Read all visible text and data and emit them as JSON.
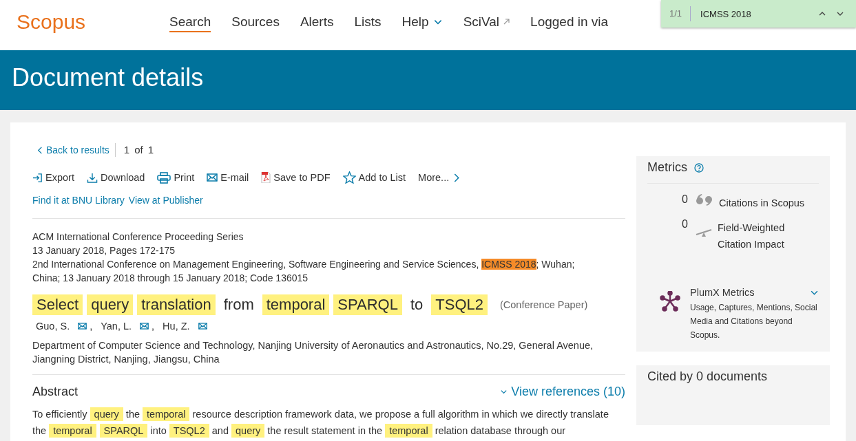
{
  "header": {
    "logo": "Scopus",
    "nav": [
      {
        "label": "Search",
        "selected": true,
        "kind": "link"
      },
      {
        "label": "Sources",
        "selected": false,
        "kind": "link"
      },
      {
        "label": "Alerts",
        "selected": false,
        "kind": "link"
      },
      {
        "label": "Lists",
        "selected": false,
        "kind": "link"
      },
      {
        "label": "Help",
        "selected": false,
        "kind": "menu"
      },
      {
        "label": "SciVal",
        "selected": false,
        "kind": "external"
      },
      {
        "label": "Logged in via",
        "selected": false,
        "kind": "link"
      }
    ]
  },
  "find_bar": {
    "count": "1/1",
    "query": "ICMSS 2018"
  },
  "page_title": "Document details",
  "back_link": "Back to results",
  "pager": {
    "current": "1",
    "of": "of",
    "total": "1"
  },
  "actions": [
    {
      "label": "Export",
      "kind": "export"
    },
    {
      "label": "Download",
      "kind": "download"
    },
    {
      "label": "Print",
      "kind": "print"
    },
    {
      "label": "E-mail",
      "kind": "email"
    },
    {
      "label": "Save to PDF",
      "kind": "pdf"
    },
    {
      "label": "Add to List",
      "kind": "star"
    },
    {
      "label": "More...",
      "kind": "more"
    }
  ],
  "links": [
    "Find it at BNU Library",
    "View at Publisher"
  ],
  "source": {
    "series": "ACM International Conference Proceeding Series",
    "date_pages": "13 January 2018, Pages 172-175",
    "conference": [
      {
        "text": "2nd International Conference on Management Engineering, Software Engineering and Service Sciences, ",
        "kind": "plain"
      },
      {
        "text": "ICMSS 2018",
        "kind": "current"
      },
      {
        "text": "; Wuhan; China; 13 January 2018 through 15 January 2018; Code 136015",
        "kind": "plain"
      }
    ]
  },
  "title": {
    "words": [
      {
        "text": "Select",
        "kind": "match"
      },
      {
        "text": "query",
        "kind": "match"
      },
      {
        "text": "translation",
        "kind": "match"
      },
      {
        "text": "from",
        "kind": "plain"
      },
      {
        "text": "temporal",
        "kind": "match"
      },
      {
        "text": "SPARQL",
        "kind": "match"
      },
      {
        "text": "to",
        "kind": "plain"
      },
      {
        "text": "TSQL2",
        "kind": "match"
      }
    ],
    "doc_type": "(Conference Paper)"
  },
  "authors": [
    {
      "name": "Guo, S.",
      "separator": ","
    },
    {
      "name": "Yan, L.",
      "separator": ","
    },
    {
      "name": "Hu, Z."
    }
  ],
  "affiliation": "Department of Computer Science and Technology, Nanjing University of Aeronautics and Astronautics, No.29, General Avenue, Jiangning District, Nanjing, Jiangsu, China",
  "abstract": {
    "heading": "Abstract",
    "references_link": "View references (10)",
    "segments": [
      {
        "text": "To efficiently ",
        "kind": "plain"
      },
      {
        "text": "query",
        "kind": "match"
      },
      {
        "text": " the ",
        "kind": "plain"
      },
      {
        "text": "temporal",
        "kind": "match"
      },
      {
        "text": " resource description framework data, we propose a full algorithm in which we directly translate the ",
        "kind": "plain"
      },
      {
        "text": "temporal",
        "kind": "match"
      },
      {
        "text": "SPARQL",
        "kind": "match"
      },
      {
        "text": " into ",
        "kind": "plain"
      },
      {
        "text": "TSQL2",
        "kind": "match"
      },
      {
        "text": " and ",
        "kind": "plain"
      },
      {
        "text": "query",
        "kind": "match"
      },
      {
        "text": " the result statement in the ",
        "kind": "plain"
      },
      {
        "text": "temporal",
        "kind": "match"
      },
      {
        "text": " relation database through our",
        "kind": "plain"
      }
    ]
  },
  "metrics": {
    "title": "Metrics",
    "items": [
      {
        "count": "0",
        "label": "Citations in Scopus",
        "kind": "citations"
      },
      {
        "count": "0",
        "label": "Field-Weighted Citation Impact",
        "kind": "fwci"
      }
    ],
    "plumx": {
      "title": "PlumX Metrics",
      "description": "Usage, Captures, Mentions, Social Media and Citations beyond Scopus."
    }
  },
  "cited_by": {
    "title": "Cited by 0 documents"
  }
}
